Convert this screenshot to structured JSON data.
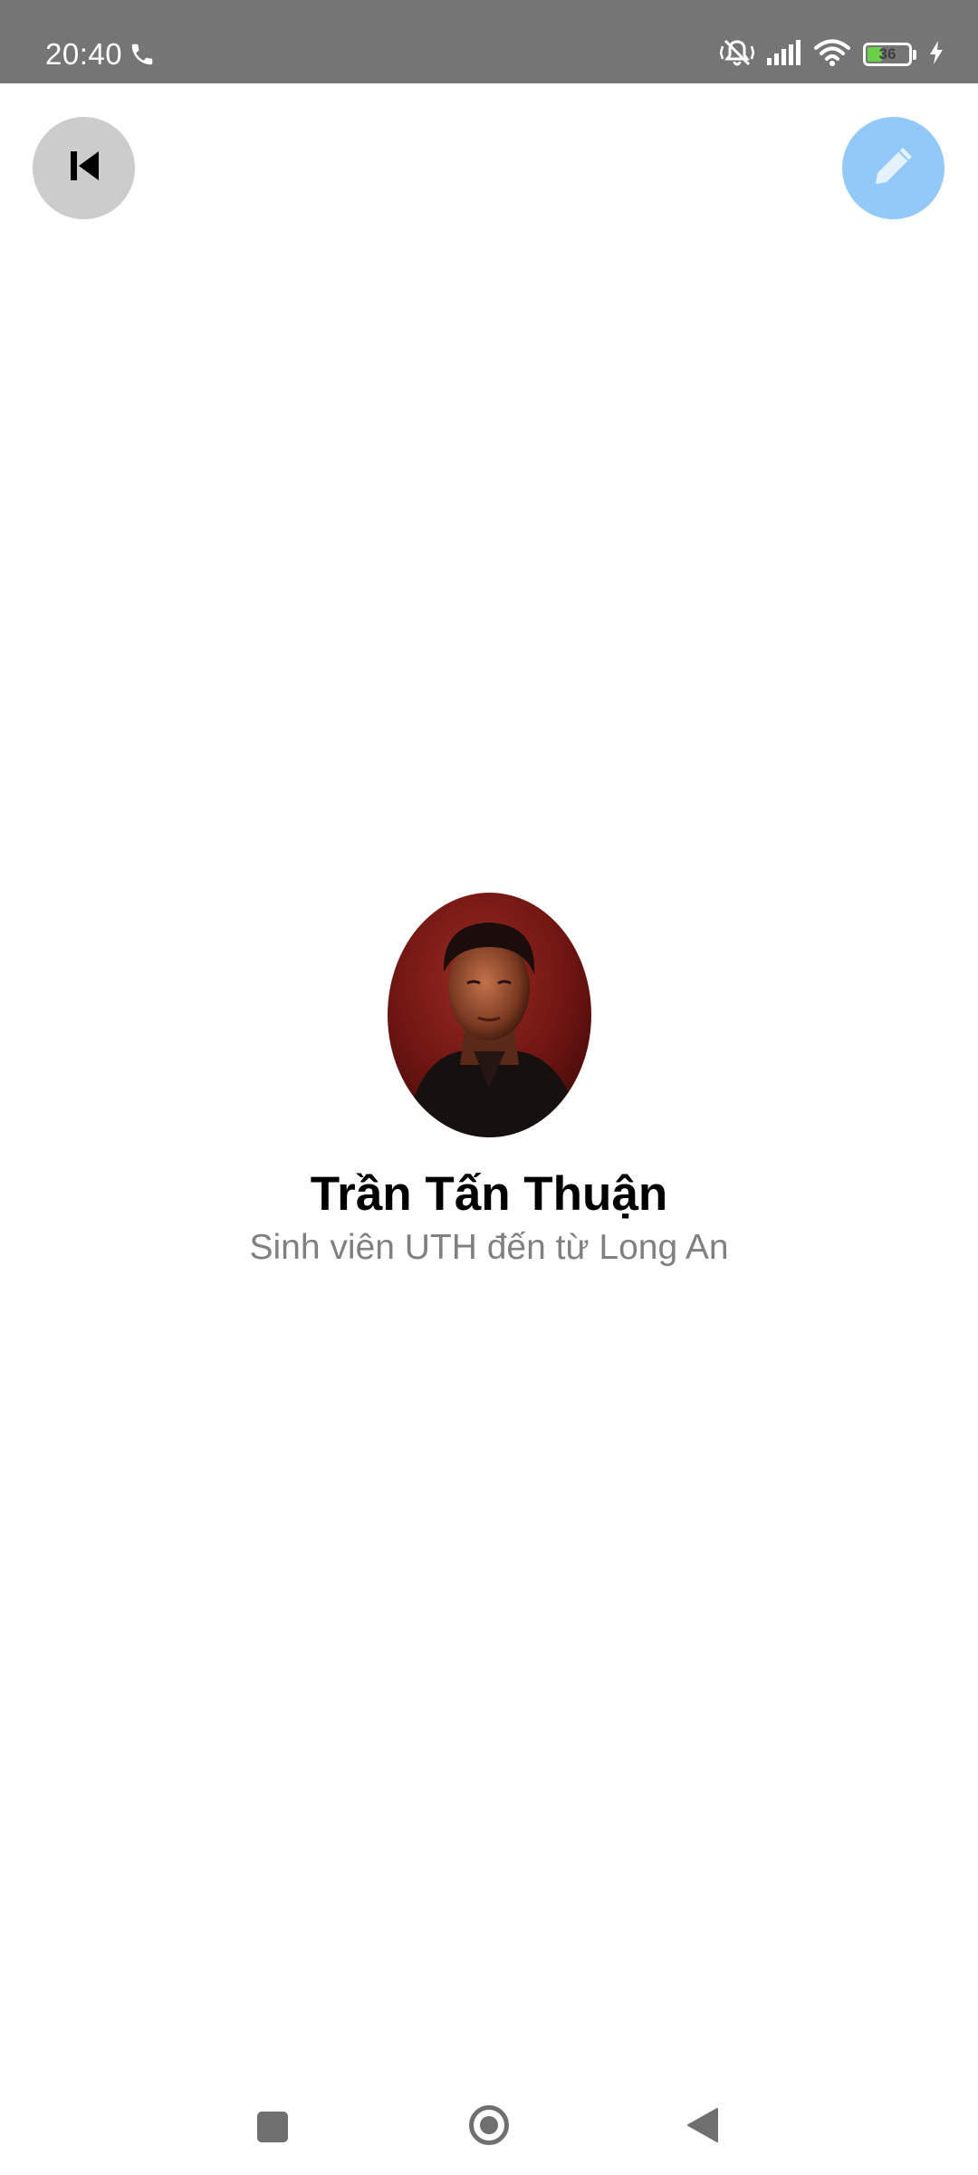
{
  "status_bar": {
    "time": "20:40",
    "call_icon": "phone-icon",
    "icons": [
      "mute-icon",
      "signal-icon",
      "wifi-icon",
      "battery-icon",
      "charging-icon"
    ],
    "battery_level": "36",
    "battery_color": "#6ccf4a"
  },
  "header": {
    "back_icon": "skip-previous-icon",
    "edit_icon": "pencil-icon",
    "back_button_color": "#cccccc",
    "edit_button_color": "#93c9f8"
  },
  "profile": {
    "name": "Trần Tấn Thuận",
    "subtitle": "Sinh viên UTH đến từ Long An"
  },
  "nav_bar": {
    "icons": [
      "recents-icon",
      "home-icon",
      "back-icon"
    ]
  }
}
